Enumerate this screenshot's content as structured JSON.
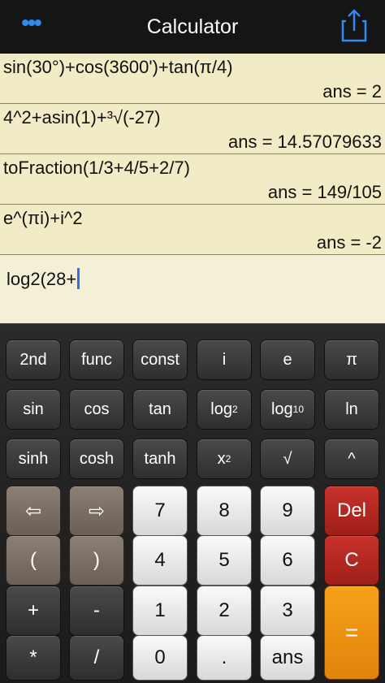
{
  "navbar": {
    "menu_icon_glyph": "•••",
    "title": "Calculator",
    "share_icon": "share-icon"
  },
  "history": [
    {
      "expression": "sin(30°)+cos(3600')+tan(π/4)",
      "answer": "ans = 2"
    },
    {
      "expression": "4^2+asin(1)+³√(-27)",
      "answer": "ans = 14.57079633"
    },
    {
      "expression": "toFraction(1/3+4/5+2/7)",
      "answer": "ans = 149/105"
    },
    {
      "expression": "e^(πi)+i^2",
      "answer": "ans = -2"
    }
  ],
  "input": {
    "text": "log2(28+"
  },
  "keys": {
    "second": "2nd",
    "func": "func",
    "const": "const",
    "i": "i",
    "e": "e",
    "pi": "π",
    "sin": "sin",
    "cos": "cos",
    "tan": "tan",
    "log2_base": "log",
    "log2_sub": "2",
    "log10_base": "log",
    "log10_sub": "10",
    "ln": "ln",
    "sinh": "sinh",
    "cosh": "cosh",
    "tanh": "tanh",
    "square_base": "x",
    "square_sup": "2",
    "sqrt": "√",
    "power": "^",
    "left": "⇦",
    "right": "⇨",
    "seven": "7",
    "eight": "8",
    "nine": "9",
    "del": "Del",
    "lparen": "(",
    "rparen": ")",
    "four": "4",
    "five": "5",
    "six": "6",
    "clear": "C",
    "plus": "+",
    "minus": "-",
    "one": "1",
    "two": "2",
    "three": "3",
    "equals": "=",
    "times": "*",
    "divide": "/",
    "zero": "0",
    "dot": ".",
    "ans": "ans"
  },
  "colors": {
    "accent": "#2f8bf2",
    "history_bg": "#f2ecc6",
    "del": "#c8322a",
    "equals": "#f7a21a"
  }
}
